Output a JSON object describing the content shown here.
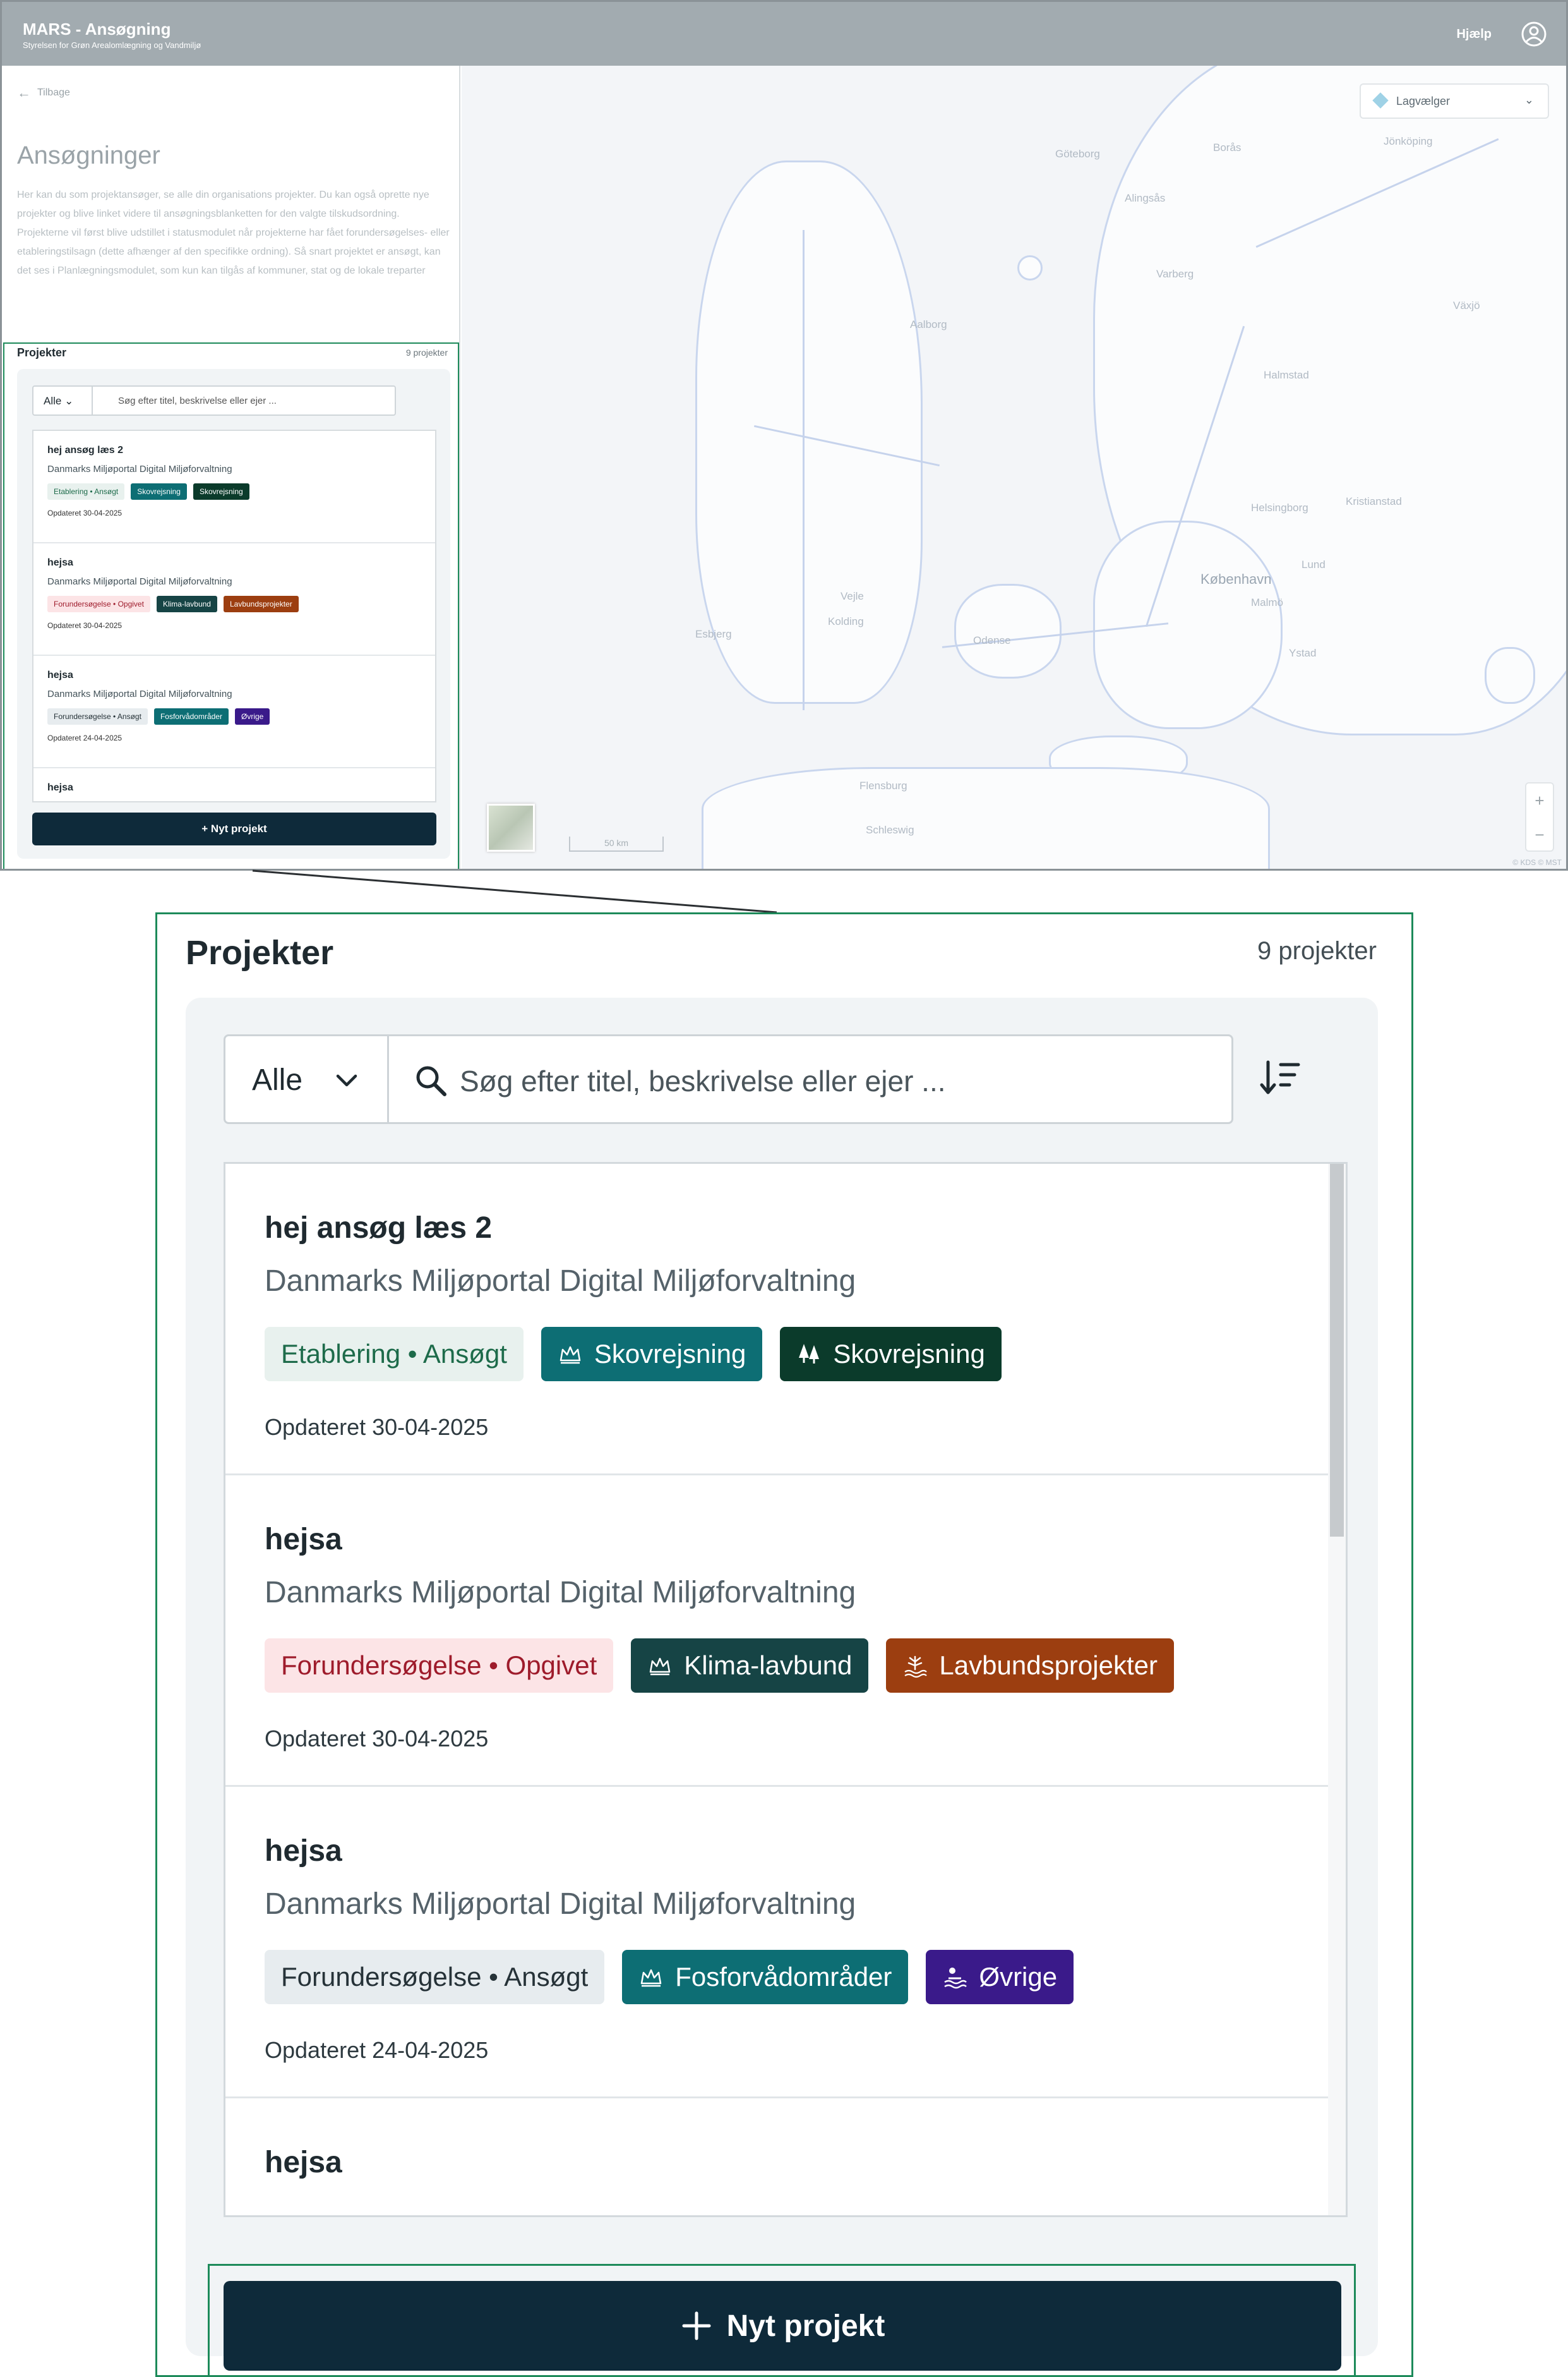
{
  "header": {
    "title": "MARS - Ansøgning",
    "subtitle": "Styrelsen for Grøn Arealomlægning og Vandmiljø",
    "help": "Hjælp"
  },
  "sidebar": {
    "back": "Tilbage",
    "heading": "Ansøgninger",
    "intro": "Her kan du som projektansøger, se alle din organisations projekter. Du kan også oprette nye projekter og blive linket videre til ansøgningsblanketten for den valgte tilskudsordning. Projekterne vil først blive udstillet i statusmodulet når projekterne har fået forundersøgelses- eller etableringstilsagn (dette afhænger af den specifikke ordning). Så snart projektet er ansøgt, kan det ses i Planlægningsmodulet, som kun kan tilgås af kommuner, stat og de lokale treparter"
  },
  "projects": {
    "title": "Projekter",
    "count": "9 projekter",
    "filter_value": "Alle",
    "search_placeholder": "Søg efter titel, beskrivelse eller ejer ...",
    "new_button": "Nyt projekt",
    "items": [
      {
        "title": "hej ansøg læs 2",
        "owner": "Danmarks Miljøportal Digital Miljøforvaltning",
        "status": "Etablering • Ansøgt",
        "tags": [
          "Skovrejsning",
          "Skovrejsning"
        ],
        "updated": "Opdateret 30-04-2025"
      },
      {
        "title": "hejsa",
        "owner": "Danmarks Miljøportal Digital Miljøforvaltning",
        "status": "Forundersøgelse • Opgivet",
        "tags": [
          "Klima-lavbund",
          "Lavbundsprojekter"
        ],
        "updated": "Opdateret 30-04-2025"
      },
      {
        "title": "hejsa",
        "owner": "Danmarks Miljøportal Digital Miljøforvaltning",
        "status": "Forundersøgelse • Ansøgt",
        "tags": [
          "Fosforvådområder",
          "Øvrige"
        ],
        "updated": "Opdateret 24-04-2025"
      },
      {
        "title": "hejsa"
      }
    ]
  },
  "map": {
    "layer_select": "Lagvælger",
    "scale": "50 km",
    "attribution": "© KDS © MST",
    "zoom_in": "+",
    "zoom_out": "−",
    "cities": [
      "Göteborg",
      "Borås",
      "Jönköping",
      "Alingsås",
      "Varberg",
      "Aalborg",
      "Växjö",
      "Halmstad",
      "Helsingborg",
      "Kristianstad",
      "København",
      "Malmö",
      "Odense",
      "Vejle",
      "Esbjerg",
      "Kolding",
      "Lund",
      "Ystad",
      "Flensburg",
      "Schleswig"
    ]
  },
  "colors": {
    "header_bg": "#a2abb0",
    "button_bg": "#0e2a3a",
    "accent_green": "#1d8a5a",
    "status_established": "#e8f1ee",
    "status_abandoned": "#fce4e6",
    "status_applied": "#e7ecef",
    "tag_teal": "#0d6e74",
    "tag_darkgreen": "#0b3b2b",
    "tag_slate": "#164445",
    "tag_brown": "#9c3e10",
    "tag_purple": "#3a1a8a"
  }
}
